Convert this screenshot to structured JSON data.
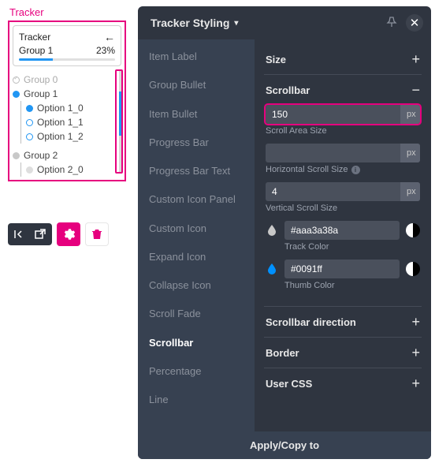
{
  "preview": {
    "title": "Tracker",
    "card_title": "Tracker",
    "group_label": "Group 1",
    "percent": "23%",
    "tree": {
      "g0": "Group 0",
      "g1": "Group 1",
      "g1_opts": [
        "Option 1_0",
        "Option 1_1",
        "Option 1_2"
      ],
      "g2": "Group 2",
      "g2_opts": [
        "Option 2_0"
      ]
    }
  },
  "panel": {
    "title": "Tracker Styling",
    "side_items": [
      "Item Label",
      "Group Bullet",
      "Item Bullet",
      "Progress Bar",
      "Progress Bar Text",
      "Custom Icon Panel",
      "Custom Icon",
      "Expand Icon",
      "Collapse Icon",
      "Scroll Fade",
      "Scrollbar",
      "Percentage",
      "Line"
    ],
    "side_active_index": 10,
    "sections": {
      "size": "Size",
      "scrollbar": "Scrollbar",
      "direction": "Scrollbar direction",
      "border": "Border",
      "usercss": "User CSS"
    },
    "scrollbar": {
      "scroll_area_size_value": "150",
      "scroll_area_size_unit": "px",
      "scroll_area_size_label": "Scroll Area Size",
      "h_scroll_value": "",
      "h_scroll_unit": "px",
      "h_scroll_label": "Horizontal Scroll Size",
      "v_scroll_value": "4",
      "v_scroll_unit": "px",
      "v_scroll_label": "Vertical Scroll Size",
      "track_color": "#aaa3a38a",
      "track_label": "Track Color",
      "thumb_color": "#0091ff",
      "thumb_label": "Thumb Color"
    },
    "footer": "Apply/Copy to"
  }
}
